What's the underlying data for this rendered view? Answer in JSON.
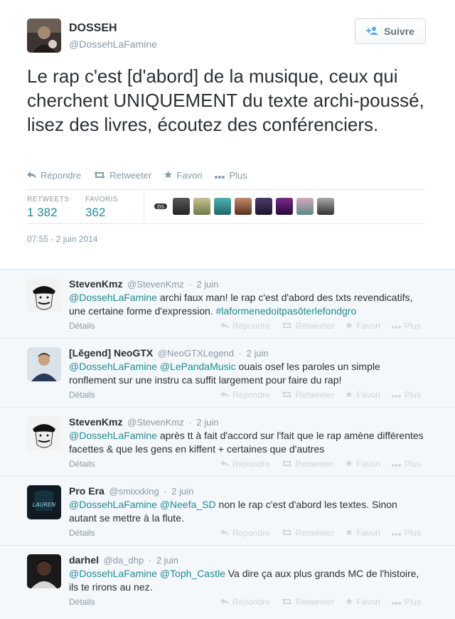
{
  "tweet": {
    "author_name": "DOSSEH",
    "author_handle": "@DossehLaFamine",
    "follow_label": "Suivre",
    "text": "Le rap c'est [d'abord] de la musique, ceux qui cherchent UNIQUEMENT du texte archi-poussé, lisez des livres, écoutez des conférenciers.",
    "actions": {
      "reply": "Répondre",
      "retweet": "Retweeter",
      "favorite": "Favori",
      "more": "Plus"
    },
    "stats": {
      "retweets_label": "RETWEETS",
      "retweets_value": "1 382",
      "favorites_label": "FAVORIS",
      "favorites_value": "362"
    },
    "timestamp": "07:55 - 2 juin 2014"
  },
  "reply_actions": {
    "reply": "Répondre",
    "retweet": "Retweeter",
    "favorite": "Favori",
    "more": "Plus",
    "details": "Détails"
  },
  "replies": [
    {
      "name": "StevenKmz",
      "handle": "@StevenKmz",
      "date": "2 juin",
      "mention": "@DossehLaFamine",
      "text": "archi faux man! le rap c'est d'abord des txts revendicatifs, une certaine forme d'expression.",
      "hashtag": "#laformenedoitpasôterlefondgro"
    },
    {
      "name": "[Lĕgend] NeoGTX",
      "handle": "@NeoGTXLegend",
      "date": "2 juin",
      "mention": "@DossehLaFamine @LePandaMusic",
      "text": "ouais osef les paroles un simple ronflement sur une instru ca suffit largement pour faire du rap!"
    },
    {
      "name": "StevenKmz",
      "handle": "@StevenKmz",
      "date": "2 juin",
      "mention": "@DossehLaFamine",
      "text": "après tt à fait d'accord sur l'fait que le rap amène différentes facettes & que les gens en kiffent + certaines que d'autres"
    },
    {
      "name": "Pro Era",
      "handle": "@smixxking",
      "date": "2 juin",
      "mention": "@DossehLaFamine @Neefa_SD",
      "text": "non le rap c'est d'abord les textes. Sinon autant se mettre à la flute."
    },
    {
      "name": "darhel",
      "handle": "@da_dhp",
      "date": "2 juin",
      "mention": "@DossehLaFamine @Toph_Castle",
      "text": "Va dire ça aux plus grands MC de l'histoire, ils te rirons au nez."
    }
  ],
  "colors": {
    "link": "#1f8a95",
    "muted": "#8899a6",
    "reply_bg": "#f5f8fa"
  }
}
